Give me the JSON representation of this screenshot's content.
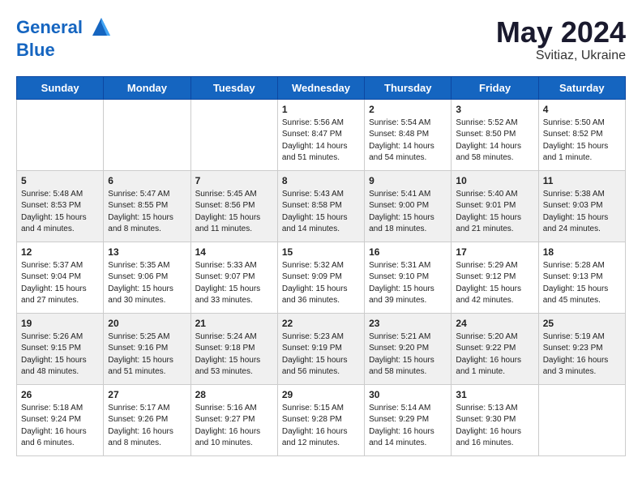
{
  "logo": {
    "line1": "General",
    "line2": "Blue"
  },
  "title": {
    "month_year": "May 2024",
    "location": "Svitiaz, Ukraine"
  },
  "days_of_week": [
    "Sunday",
    "Monday",
    "Tuesday",
    "Wednesday",
    "Thursday",
    "Friday",
    "Saturday"
  ],
  "weeks": [
    [
      {
        "day": "",
        "info": ""
      },
      {
        "day": "",
        "info": ""
      },
      {
        "day": "",
        "info": ""
      },
      {
        "day": "1",
        "info": "Sunrise: 5:56 AM\nSunset: 8:47 PM\nDaylight: 14 hours\nand 51 minutes."
      },
      {
        "day": "2",
        "info": "Sunrise: 5:54 AM\nSunset: 8:48 PM\nDaylight: 14 hours\nand 54 minutes."
      },
      {
        "day": "3",
        "info": "Sunrise: 5:52 AM\nSunset: 8:50 PM\nDaylight: 14 hours\nand 58 minutes."
      },
      {
        "day": "4",
        "info": "Sunrise: 5:50 AM\nSunset: 8:52 PM\nDaylight: 15 hours\nand 1 minute."
      }
    ],
    [
      {
        "day": "5",
        "info": "Sunrise: 5:48 AM\nSunset: 8:53 PM\nDaylight: 15 hours\nand 4 minutes."
      },
      {
        "day": "6",
        "info": "Sunrise: 5:47 AM\nSunset: 8:55 PM\nDaylight: 15 hours\nand 8 minutes."
      },
      {
        "day": "7",
        "info": "Sunrise: 5:45 AM\nSunset: 8:56 PM\nDaylight: 15 hours\nand 11 minutes."
      },
      {
        "day": "8",
        "info": "Sunrise: 5:43 AM\nSunset: 8:58 PM\nDaylight: 15 hours\nand 14 minutes."
      },
      {
        "day": "9",
        "info": "Sunrise: 5:41 AM\nSunset: 9:00 PM\nDaylight: 15 hours\nand 18 minutes."
      },
      {
        "day": "10",
        "info": "Sunrise: 5:40 AM\nSunset: 9:01 PM\nDaylight: 15 hours\nand 21 minutes."
      },
      {
        "day": "11",
        "info": "Sunrise: 5:38 AM\nSunset: 9:03 PM\nDaylight: 15 hours\nand 24 minutes."
      }
    ],
    [
      {
        "day": "12",
        "info": "Sunrise: 5:37 AM\nSunset: 9:04 PM\nDaylight: 15 hours\nand 27 minutes."
      },
      {
        "day": "13",
        "info": "Sunrise: 5:35 AM\nSunset: 9:06 PM\nDaylight: 15 hours\nand 30 minutes."
      },
      {
        "day": "14",
        "info": "Sunrise: 5:33 AM\nSunset: 9:07 PM\nDaylight: 15 hours\nand 33 minutes."
      },
      {
        "day": "15",
        "info": "Sunrise: 5:32 AM\nSunset: 9:09 PM\nDaylight: 15 hours\nand 36 minutes."
      },
      {
        "day": "16",
        "info": "Sunrise: 5:31 AM\nSunset: 9:10 PM\nDaylight: 15 hours\nand 39 minutes."
      },
      {
        "day": "17",
        "info": "Sunrise: 5:29 AM\nSunset: 9:12 PM\nDaylight: 15 hours\nand 42 minutes."
      },
      {
        "day": "18",
        "info": "Sunrise: 5:28 AM\nSunset: 9:13 PM\nDaylight: 15 hours\nand 45 minutes."
      }
    ],
    [
      {
        "day": "19",
        "info": "Sunrise: 5:26 AM\nSunset: 9:15 PM\nDaylight: 15 hours\nand 48 minutes."
      },
      {
        "day": "20",
        "info": "Sunrise: 5:25 AM\nSunset: 9:16 PM\nDaylight: 15 hours\nand 51 minutes."
      },
      {
        "day": "21",
        "info": "Sunrise: 5:24 AM\nSunset: 9:18 PM\nDaylight: 15 hours\nand 53 minutes."
      },
      {
        "day": "22",
        "info": "Sunrise: 5:23 AM\nSunset: 9:19 PM\nDaylight: 15 hours\nand 56 minutes."
      },
      {
        "day": "23",
        "info": "Sunrise: 5:21 AM\nSunset: 9:20 PM\nDaylight: 15 hours\nand 58 minutes."
      },
      {
        "day": "24",
        "info": "Sunrise: 5:20 AM\nSunset: 9:22 PM\nDaylight: 16 hours\nand 1 minute."
      },
      {
        "day": "25",
        "info": "Sunrise: 5:19 AM\nSunset: 9:23 PM\nDaylight: 16 hours\nand 3 minutes."
      }
    ],
    [
      {
        "day": "26",
        "info": "Sunrise: 5:18 AM\nSunset: 9:24 PM\nDaylight: 16 hours\nand 6 minutes."
      },
      {
        "day": "27",
        "info": "Sunrise: 5:17 AM\nSunset: 9:26 PM\nDaylight: 16 hours\nand 8 minutes."
      },
      {
        "day": "28",
        "info": "Sunrise: 5:16 AM\nSunset: 9:27 PM\nDaylight: 16 hours\nand 10 minutes."
      },
      {
        "day": "29",
        "info": "Sunrise: 5:15 AM\nSunset: 9:28 PM\nDaylight: 16 hours\nand 12 minutes."
      },
      {
        "day": "30",
        "info": "Sunrise: 5:14 AM\nSunset: 9:29 PM\nDaylight: 16 hours\nand 14 minutes."
      },
      {
        "day": "31",
        "info": "Sunrise: 5:13 AM\nSunset: 9:30 PM\nDaylight: 16 hours\nand 16 minutes."
      },
      {
        "day": "",
        "info": ""
      }
    ]
  ]
}
